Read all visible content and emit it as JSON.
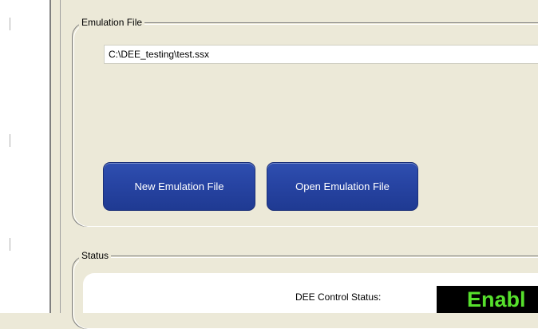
{
  "emulation_file": {
    "legend": "Emulation File",
    "path_value": "C:\\DEE_testing\\test.ssx",
    "new_button_label": "New Emulation File",
    "open_button_label": "Open Emulation File"
  },
  "status": {
    "legend": "Status",
    "control_status_label": "DEE Control Status:",
    "control_status_value": "Enabl"
  },
  "colors": {
    "button_blue": "#2744a3",
    "status_text_green": "#56e02c",
    "window_background": "#ece9d8"
  }
}
